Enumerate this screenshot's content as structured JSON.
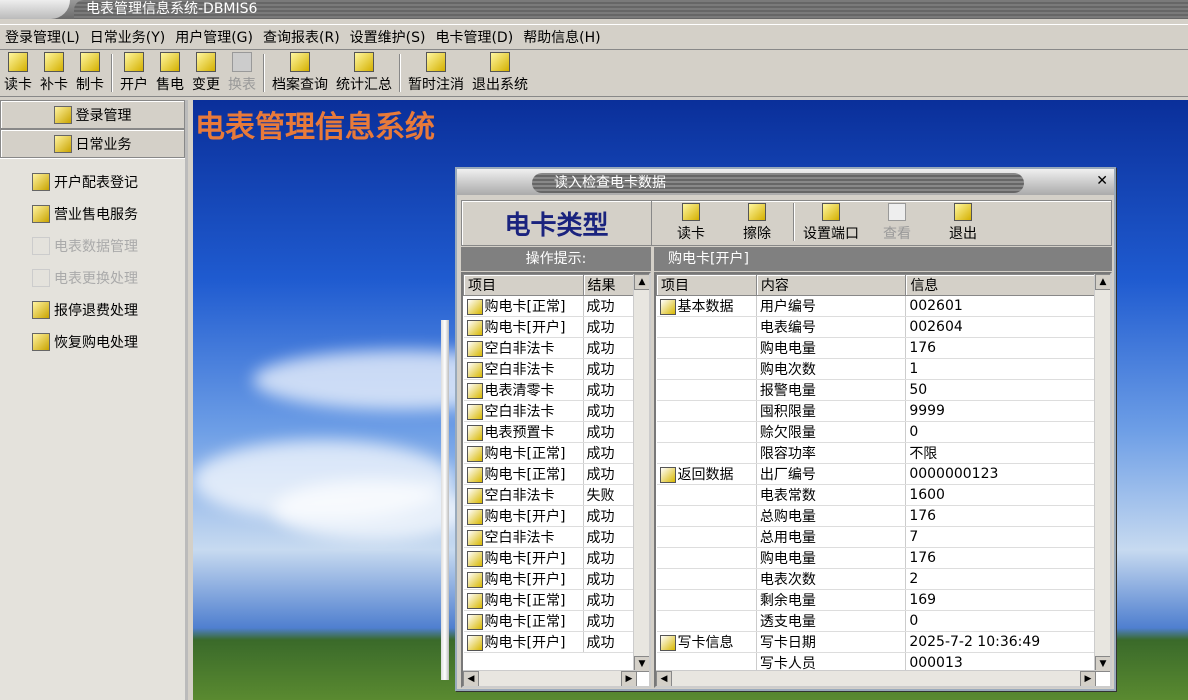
{
  "window": {
    "title": "电表管理信息系统-DBMIS6"
  },
  "menu": [
    "登录管理(L)",
    "日常业务(Y)",
    "用户管理(G)",
    "查询报表(R)",
    "设置维护(S)",
    "电卡管理(D)",
    "帮助信息(H)"
  ],
  "toolbar": [
    {
      "label": "读卡"
    },
    {
      "label": "补卡"
    },
    {
      "label": "制卡"
    },
    {
      "sep": true
    },
    {
      "label": "开户"
    },
    {
      "label": "售电"
    },
    {
      "label": "变更"
    },
    {
      "label": "换表",
      "disabled": true
    },
    {
      "sep": true
    },
    {
      "label": "档案查询"
    },
    {
      "label": "统计汇总"
    },
    {
      "sep": true
    },
    {
      "label": "暂时注消"
    },
    {
      "label": "退出系统"
    }
  ],
  "sidebar": {
    "groups": [
      "登录管理",
      "日常业务"
    ],
    "items": [
      {
        "label": "开户配表登记"
      },
      {
        "label": "营业售电服务"
      },
      {
        "label": "电表数据管理",
        "disabled": true
      },
      {
        "label": "电表更换处理",
        "disabled": true
      },
      {
        "label": "报停退费处理"
      },
      {
        "label": "恢复购电处理"
      }
    ]
  },
  "desktop": {
    "app_title": "电表管理信息系统"
  },
  "dialog": {
    "title": "读入检查电卡数据",
    "card_type": "电卡类型",
    "buttons": [
      {
        "label": "读卡"
      },
      {
        "label": "擦除"
      },
      {
        "label": "设置端口"
      },
      {
        "label": "查看",
        "disabled": true
      },
      {
        "label": "退出"
      }
    ],
    "left_header": "操作提示:",
    "right_header": "购电卡[开户]",
    "left_columns": [
      "项目",
      "结果"
    ],
    "left_rows": [
      [
        "购电卡[正常]",
        "成功"
      ],
      [
        "购电卡[开户]",
        "成功"
      ],
      [
        "空白非法卡",
        "成功"
      ],
      [
        "空白非法卡",
        "成功"
      ],
      [
        "电表清零卡",
        "成功"
      ],
      [
        "空白非法卡",
        "成功"
      ],
      [
        "电表预置卡",
        "成功"
      ],
      [
        "购电卡[正常]",
        "成功"
      ],
      [
        "购电卡[正常]",
        "成功"
      ],
      [
        "空白非法卡",
        "失败"
      ],
      [
        "购电卡[开户]",
        "成功"
      ],
      [
        "空白非法卡",
        "成功"
      ],
      [
        "购电卡[开户]",
        "成功"
      ],
      [
        "购电卡[开户]",
        "成功"
      ],
      [
        "购电卡[正常]",
        "成功"
      ],
      [
        "购电卡[正常]",
        "成功"
      ],
      [
        "购电卡[开户]",
        "成功"
      ]
    ],
    "right_columns": [
      "项目",
      "内容",
      "信息"
    ],
    "right_rows": [
      [
        "基本数据",
        "用户编号",
        "002601"
      ],
      [
        "",
        "电表编号",
        "002604"
      ],
      [
        "",
        "购电电量",
        "176"
      ],
      [
        "",
        "购电次数",
        "1"
      ],
      [
        "",
        "报警电量",
        "50"
      ],
      [
        "",
        "囤积限量",
        "9999"
      ],
      [
        "",
        "赊欠限量",
        "0"
      ],
      [
        "",
        "限容功率",
        "不限"
      ],
      [
        "返回数据",
        "出厂编号",
        "0000000123"
      ],
      [
        "",
        "电表常数",
        "1600"
      ],
      [
        "",
        "总购电量",
        "176"
      ],
      [
        "",
        "总用电量",
        "7"
      ],
      [
        "",
        "购电电量",
        "176"
      ],
      [
        "",
        "电表次数",
        "2"
      ],
      [
        "",
        "剩余电量",
        "169"
      ],
      [
        "",
        "透支电量",
        "0"
      ],
      [
        "写卡信息",
        "写卡日期",
        "2025-7-2 10:36:49"
      ],
      [
        "",
        "写卡人员",
        "000013"
      ]
    ]
  }
}
